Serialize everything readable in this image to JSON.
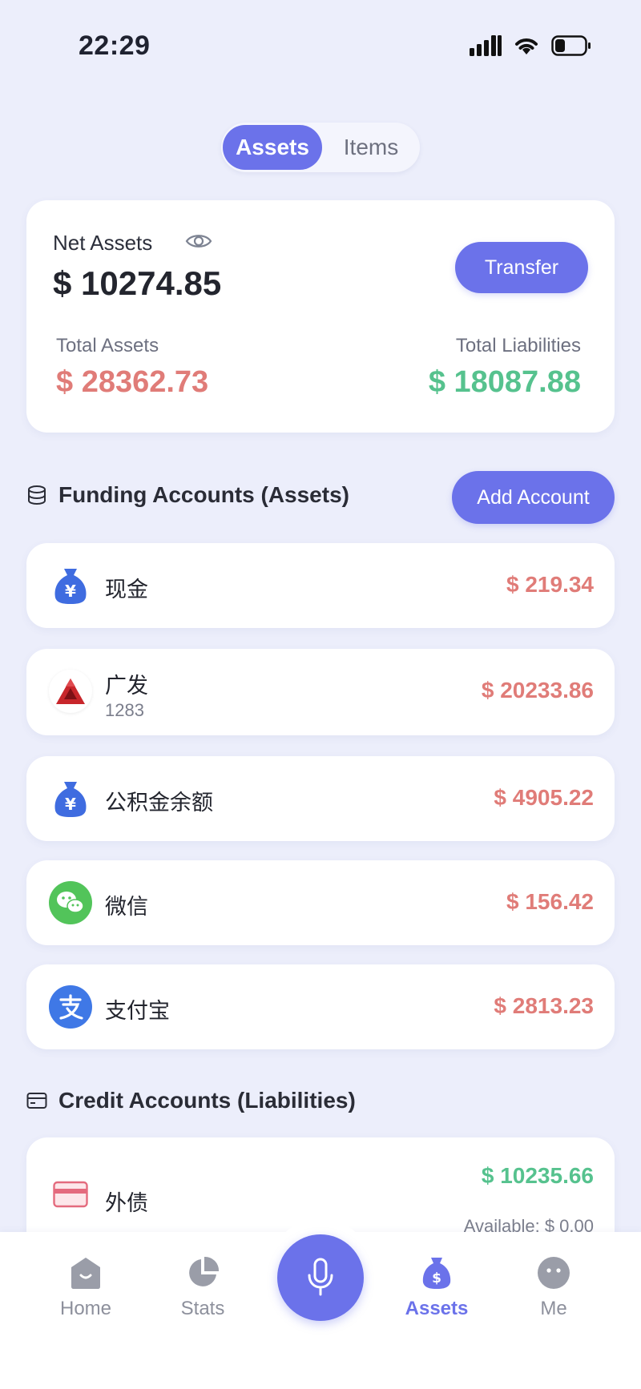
{
  "status_bar": {
    "time": "22:29"
  },
  "segment": {
    "tabs": [
      {
        "label": "Assets",
        "active": true
      },
      {
        "label": "Items",
        "active": false
      }
    ]
  },
  "summary": {
    "net_label": "Net Assets",
    "net_value": "$ 10274.85",
    "transfer_label": "Transfer",
    "total_assets_label": "Total Assets",
    "total_assets_value": "$ 28362.73",
    "total_liabilities_label": "Total Liabilities",
    "total_liabilities_value": "$ 18087.88"
  },
  "funding": {
    "title": "Funding Accounts (Assets)",
    "add_label": "Add Account",
    "accounts": [
      {
        "name": "现金",
        "sub": "",
        "amount": "$ 219.34",
        "icon": "money-bag-icon"
      },
      {
        "name": "广发",
        "sub": "1283",
        "amount": "$ 20233.86",
        "icon": "bank-logo-icon"
      },
      {
        "name": "公积金余额",
        "sub": "",
        "amount": "$ 4905.22",
        "icon": "money-bag-icon"
      },
      {
        "name": "微信",
        "sub": "",
        "amount": "$ 156.42",
        "icon": "wechat-icon"
      },
      {
        "name": "支付宝",
        "sub": "",
        "amount": "$ 2813.23",
        "icon": "alipay-icon"
      }
    ]
  },
  "credit": {
    "title": "Credit Accounts (Liabilities)",
    "accounts": [
      {
        "name": "外债",
        "amount": "$ 10235.66",
        "available": "Available: $ 0.00",
        "icon": "credit-card-icon"
      }
    ]
  },
  "tabbar": {
    "items": [
      {
        "label": "Home",
        "icon": "home-icon"
      },
      {
        "label": "Stats",
        "icon": "pie-chart-icon"
      },
      {
        "label": "Assets",
        "icon": "money-bag-icon",
        "active": true
      },
      {
        "label": "Me",
        "icon": "face-icon"
      }
    ]
  },
  "colors": {
    "accent": "#6b72ea",
    "asset_red": "#e07c78",
    "liability_green": "#56c28e",
    "background": "#eceefb"
  }
}
